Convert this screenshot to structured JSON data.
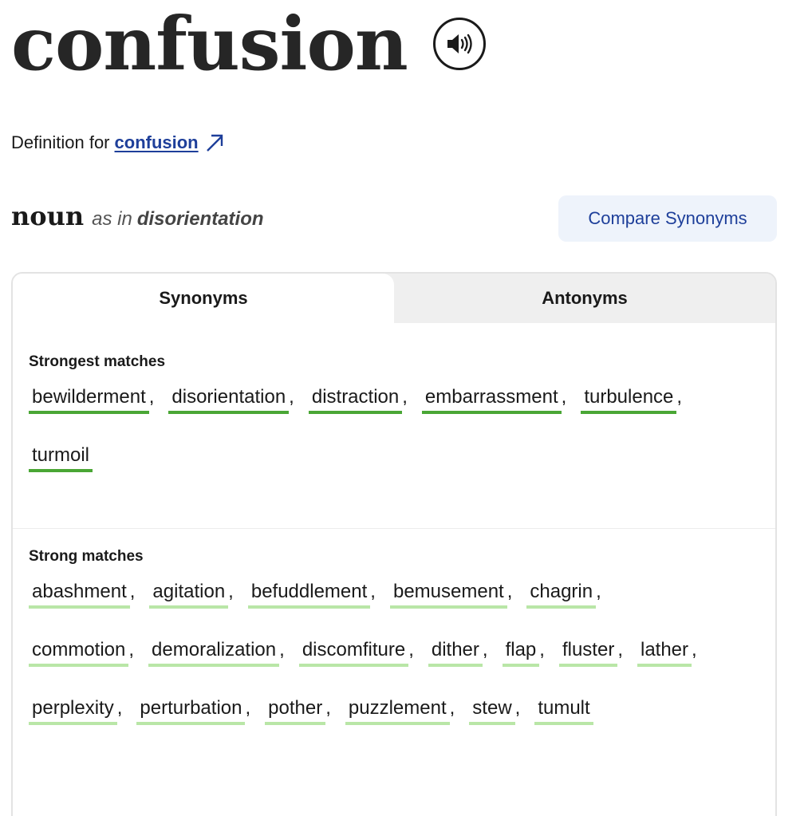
{
  "headword": "confusion",
  "definition": {
    "prefix": "Definition for",
    "link": "confusion"
  },
  "pos": {
    "part": "noun",
    "as_in": "as in",
    "sense": "disorientation"
  },
  "compare_button": "Compare Synonyms",
  "tabs": {
    "synonyms": "Synonyms",
    "antonyms": "Antonyms"
  },
  "strongest": {
    "title": "Strongest matches",
    "words": [
      "bewilderment",
      "disorientation",
      "distraction",
      "embarrassment",
      "turbulence",
      "turmoil"
    ]
  },
  "strong": {
    "title": "Strong matches",
    "words": [
      "abashment",
      "agitation",
      "befuddlement",
      "bemusement",
      "chagrin",
      "commotion",
      "demoralization",
      "discomfiture",
      "dither",
      "flap",
      "fluster",
      "lather",
      "perplexity",
      "perturbation",
      "pother",
      "puzzlement",
      "stew",
      "tumult"
    ]
  },
  "colors": {
    "strongest_underline": "#4aa635",
    "strong_underline": "#b9e6a7",
    "link": "#1e3f9a",
    "compare_bg": "#eef3fb"
  },
  "icons": {
    "audio": "speaker-icon",
    "external": "arrow-up-right-icon"
  }
}
